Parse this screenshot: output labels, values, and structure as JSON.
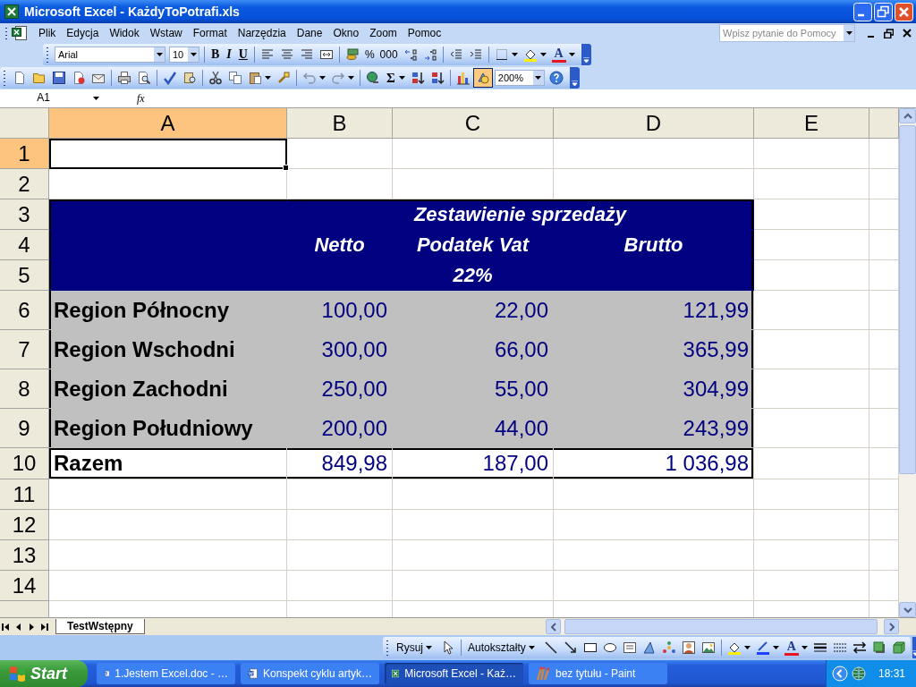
{
  "window": {
    "title": "Microsoft Excel - KażdyToPotrafi.xls"
  },
  "menu": {
    "items": [
      "Plik",
      "Edycja",
      "Widok",
      "Wstaw",
      "Format",
      "Narzędzia",
      "Dane",
      "Okno",
      "Zoom",
      "Pomoc"
    ],
    "help_box": {
      "placeholder": "Wpisz pytanie do Pomocy"
    }
  },
  "formatting_toolbar": {
    "font": "Arial",
    "size": "10",
    "labels": [
      "B",
      "I",
      "U",
      "%",
      "000",
      "A"
    ]
  },
  "standard_toolbar": {
    "labels": [
      "Σ"
    ],
    "drawing_button": {
      "selected": true
    },
    "zoom": "200%"
  },
  "formula_bar": {
    "name_box": "A1",
    "fx": "fx"
  },
  "sheet": {
    "columns": [
      {
        "label": "A",
        "selected": true
      },
      {
        "label": "B",
        "selected": false
      },
      {
        "label": "C",
        "selected": false
      },
      {
        "label": "D",
        "selected": false
      },
      {
        "label": "E",
        "selected": false
      }
    ],
    "rows": [
      {
        "label": "1",
        "kind": "blank",
        "selected": true
      },
      {
        "label": "2",
        "kind": "blank",
        "selected": false
      },
      {
        "label": "3",
        "kind": "header",
        "selected": false,
        "title": "Zestawienie sprzedaży"
      },
      {
        "label": "4",
        "kind": "header",
        "selected": false,
        "cells": [
          null,
          "Netto",
          "Podatek Vat",
          "Brutto"
        ]
      },
      {
        "label": "5",
        "kind": "header",
        "selected": false,
        "cells": [
          null,
          null,
          "22%"
        ]
      },
      {
        "label": "6",
        "kind": "data",
        "selected": false,
        "cells": [
          "Region Północny",
          "100,00",
          "22,00",
          "121,99"
        ]
      },
      {
        "label": "7",
        "kind": "data",
        "selected": false,
        "cells": [
          "Region Wschodni",
          "300,00",
          "66,00",
          "365,99"
        ]
      },
      {
        "label": "8",
        "kind": "data",
        "selected": false,
        "cells": [
          "Region Zachodni",
          "250,00",
          "55,00",
          "304,99"
        ]
      },
      {
        "label": "9",
        "kind": "data",
        "selected": false,
        "cells": [
          "Region Południowy",
          "200,00",
          "44,00",
          "243,99"
        ]
      },
      {
        "label": "10",
        "kind": "total",
        "selected": false,
        "cells": [
          "Razem",
          "849,98",
          "187,00",
          "1 036,98"
        ]
      },
      {
        "label": "11",
        "kind": "blank",
        "selected": false
      },
      {
        "label": "12",
        "kind": "blank",
        "selected": false
      },
      {
        "label": "13",
        "kind": "blank",
        "selected": false
      },
      {
        "label": "14",
        "kind": "blank",
        "selected": false
      }
    ]
  },
  "sheet_tabs": [
    {
      "label": "TestWstępny",
      "selected": true
    }
  ],
  "drawing_toolbar": {
    "labels": [
      "Rysuj",
      "Autokształty",
      "A"
    ]
  },
  "taskbar": {
    "start": "Start",
    "tasks": [
      {
        "label": "1.Jestem Excel.doc - …",
        "kind": "word",
        "selected": false
      },
      {
        "label": "Konspekt cyklu artyk…",
        "kind": "word",
        "selected": false
      },
      {
        "label": "Microsoft Excel - Każ…",
        "kind": "excel",
        "selected": true
      },
      {
        "label": "bez tytułu - Paint",
        "kind": "paint",
        "selected": false
      }
    ],
    "clock": "18:31"
  }
}
